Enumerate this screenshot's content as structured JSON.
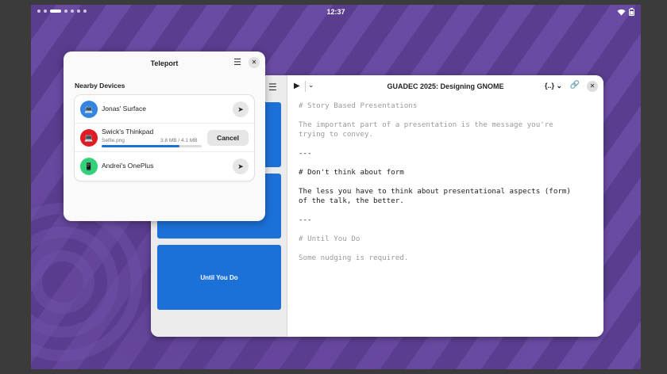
{
  "topbar": {
    "clock": "12:37",
    "wifi_icon": "wifi-icon",
    "battery_icon": "battery-icon"
  },
  "editor": {
    "title": "GUADEC 2025: Designing GNOME",
    "brace_label": "{..}",
    "slides": [
      "",
      "",
      "Until You Do"
    ],
    "markdown": [
      {
        "text": "# Story Based Presentations",
        "dim": true
      },
      {
        "text": "",
        "dim": false
      },
      {
        "text": "The important part of a presentation is the message you're",
        "dim": true
      },
      {
        "text": "trying to convey.",
        "dim": true
      },
      {
        "text": "",
        "dim": false
      },
      {
        "text": "---",
        "dim": false
      },
      {
        "text": "",
        "dim": false
      },
      {
        "text": "# Don't think about form",
        "dim": false
      },
      {
        "text": "",
        "dim": false
      },
      {
        "text": "The less you have to think about presentational aspects (form)",
        "dim": false
      },
      {
        "text": "of the talk, the better.",
        "dim": false
      },
      {
        "text": "",
        "dim": false
      },
      {
        "text": "---",
        "dim": false
      },
      {
        "text": "",
        "dim": false
      },
      {
        "text": "# Until You Do",
        "dim": true
      },
      {
        "text": "",
        "dim": false
      },
      {
        "text": "Some nudging is required.",
        "dim": true
      }
    ]
  },
  "teleport": {
    "title": "Teleport",
    "heading": "Nearby Devices",
    "devices": [
      {
        "name": "Jonas' Surface",
        "icon": "laptop-icon",
        "color": "#3584e4"
      },
      {
        "name": "Swick's Thinkpad",
        "icon": "laptop-icon",
        "color": "#e01b24",
        "file": "Selfie.png",
        "size": "3.8 MB / 4.1 MB",
        "progress": 0.78,
        "cancel_label": "Cancel"
      },
      {
        "name": "Andrei's OnePlus",
        "icon": "phone-icon",
        "color": "#33d17a"
      }
    ]
  }
}
